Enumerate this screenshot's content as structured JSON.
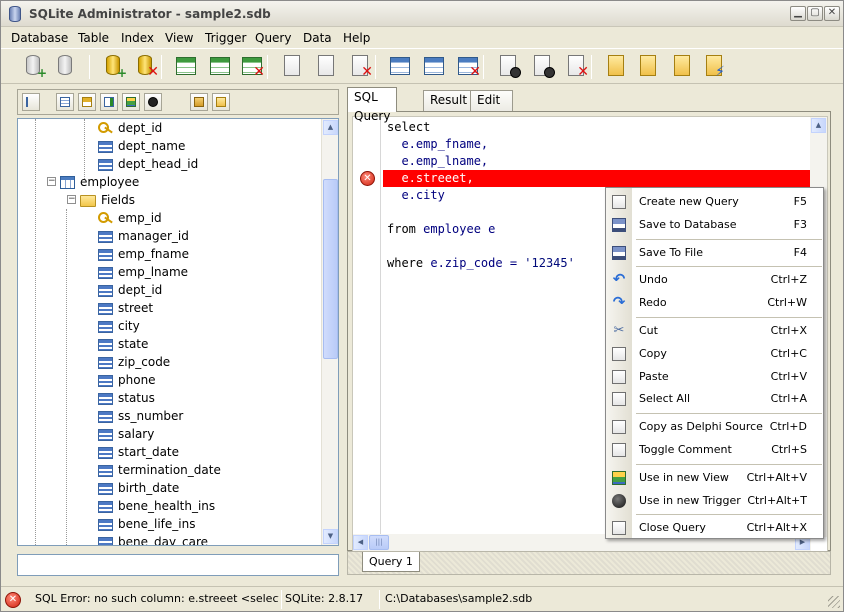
{
  "window": {
    "title": "SQLite Administrator - sample2.sdb"
  },
  "menu": [
    "Database",
    "Table",
    "Index",
    "View",
    "Trigger",
    "Query",
    "Data",
    "Help"
  ],
  "toolbar": {
    "icons": [
      "add-database-icon",
      "database-dropdown-icon",
      "refresh-database-icon",
      "delete-database-icon",
      "table-icon",
      "edit-table-icon",
      "delete-table-icon",
      "query-icon",
      "edit-query-icon",
      "delete-query-icon",
      "create-view-icon",
      "edit-view-icon",
      "delete-view-icon",
      "create-trigger-icon",
      "edit-trigger-icon",
      "delete-trigger-icon",
      "new-document-icon",
      "save-document-icon",
      "settings-database-icon",
      "execute-database-icon"
    ]
  },
  "tree": {
    "rows": [
      {
        "label": "dept_id",
        "icon": "key",
        "indent": 2
      },
      {
        "label": "dept_name",
        "icon": "field",
        "indent": 2
      },
      {
        "label": "dept_head_id",
        "icon": "field",
        "indent": 2
      },
      {
        "label": "employee",
        "icon": "table",
        "indent": 0,
        "expander": "-"
      },
      {
        "label": "Fields",
        "icon": "folder",
        "indent": 1,
        "expander": "-"
      },
      {
        "label": "emp_id",
        "icon": "key",
        "indent": 2
      },
      {
        "label": "manager_id",
        "icon": "field",
        "indent": 2
      },
      {
        "label": "emp_fname",
        "icon": "field",
        "indent": 2
      },
      {
        "label": "emp_lname",
        "icon": "field",
        "indent": 2
      },
      {
        "label": "dept_id",
        "icon": "field",
        "indent": 2
      },
      {
        "label": "street",
        "icon": "field",
        "indent": 2
      },
      {
        "label": "city",
        "icon": "field",
        "indent": 2
      },
      {
        "label": "state",
        "icon": "field",
        "indent": 2
      },
      {
        "label": "zip_code",
        "icon": "field",
        "indent": 2
      },
      {
        "label": "phone",
        "icon": "field",
        "indent": 2
      },
      {
        "label": "status",
        "icon": "field",
        "indent": 2
      },
      {
        "label": "ss_number",
        "icon": "field",
        "indent": 2
      },
      {
        "label": "salary",
        "icon": "field",
        "indent": 2
      },
      {
        "label": "start_date",
        "icon": "field",
        "indent": 2
      },
      {
        "label": "termination_date",
        "icon": "field",
        "indent": 2
      },
      {
        "label": "birth_date",
        "icon": "field",
        "indent": 2
      },
      {
        "label": "bene_health_ins",
        "icon": "field",
        "indent": 2
      },
      {
        "label": "bene_life_ins",
        "icon": "field",
        "indent": 2
      },
      {
        "label": "bene_day_care",
        "icon": "field",
        "indent": 2
      }
    ],
    "filter_value": ""
  },
  "tabs": [
    "SQL Query",
    "Result",
    "Edit Data"
  ],
  "editor": {
    "lines": [
      [
        {
          "t": "select",
          "c": "kw"
        }
      ],
      [
        {
          "t": "  e.emp_fname,",
          "c": "ident"
        }
      ],
      [
        {
          "t": "  e.emp_lname,",
          "c": "ident"
        }
      ],
      [
        {
          "t": "  e.streeet,",
          "c": "err"
        }
      ],
      [
        {
          "t": "  e.city",
          "c": "ident"
        }
      ],
      [],
      [
        {
          "t": "from ",
          "c": "kw"
        },
        {
          "t": "employee e",
          "c": "ident"
        }
      ],
      [],
      [
        {
          "t": "where ",
          "c": "kw"
        },
        {
          "t": "e.zip_code = ",
          "c": "ident"
        },
        {
          "t": "'12345'",
          "c": "str"
        }
      ]
    ],
    "error_line_index": 3
  },
  "query_tabs": [
    "Query 1"
  ],
  "context_menu": {
    "items": [
      {
        "label": "Create new Query",
        "shortcut": "F5",
        "icon": "new-query-icon"
      },
      {
        "label": "Save to Database",
        "shortcut": "F3",
        "icon": "save-database-icon"
      },
      {
        "sep": true
      },
      {
        "label": "Save To File",
        "shortcut": "F4",
        "icon": "save-file-icon"
      },
      {
        "sep": true
      },
      {
        "label": "Undo",
        "shortcut": "Ctrl+Z",
        "icon": "undo-icon"
      },
      {
        "label": "Redo",
        "shortcut": "Ctrl+W",
        "icon": "redo-icon"
      },
      {
        "sep": true
      },
      {
        "label": "Cut",
        "shortcut": "Ctrl+X",
        "icon": "cut-icon"
      },
      {
        "label": "Copy",
        "shortcut": "Ctrl+C",
        "icon": "copy-icon"
      },
      {
        "label": "Paste",
        "shortcut": "Ctrl+V",
        "icon": "paste-icon"
      },
      {
        "label": "Select All",
        "shortcut": "Ctrl+A",
        "icon": "select-all-icon"
      },
      {
        "sep": true
      },
      {
        "label": "Copy as Delphi Source",
        "shortcut": "Ctrl+D",
        "icon": "delphi-source-icon"
      },
      {
        "label": "Toggle Comment",
        "shortcut": "Ctrl+S",
        "icon": "toggle-comment-icon"
      },
      {
        "sep": true
      },
      {
        "label": "Use in new View",
        "shortcut": "Ctrl+Alt+V",
        "icon": "new-view-icon"
      },
      {
        "label": "Use in new Trigger",
        "shortcut": "Ctrl+Alt+T",
        "icon": "new-trigger-icon"
      },
      {
        "sep": true
      },
      {
        "label": "Close Query",
        "shortcut": "Ctrl+Alt+X",
        "icon": "close-query-icon"
      }
    ]
  },
  "status": {
    "error": "SQL Error: no such column: e.streeet  <select    e.",
    "version": "SQLite: 2.8.17",
    "path": "C:\\Databases\\sample2.sdb"
  },
  "colors": {
    "error_line": "#ff0000",
    "identifier": "#00007f"
  }
}
